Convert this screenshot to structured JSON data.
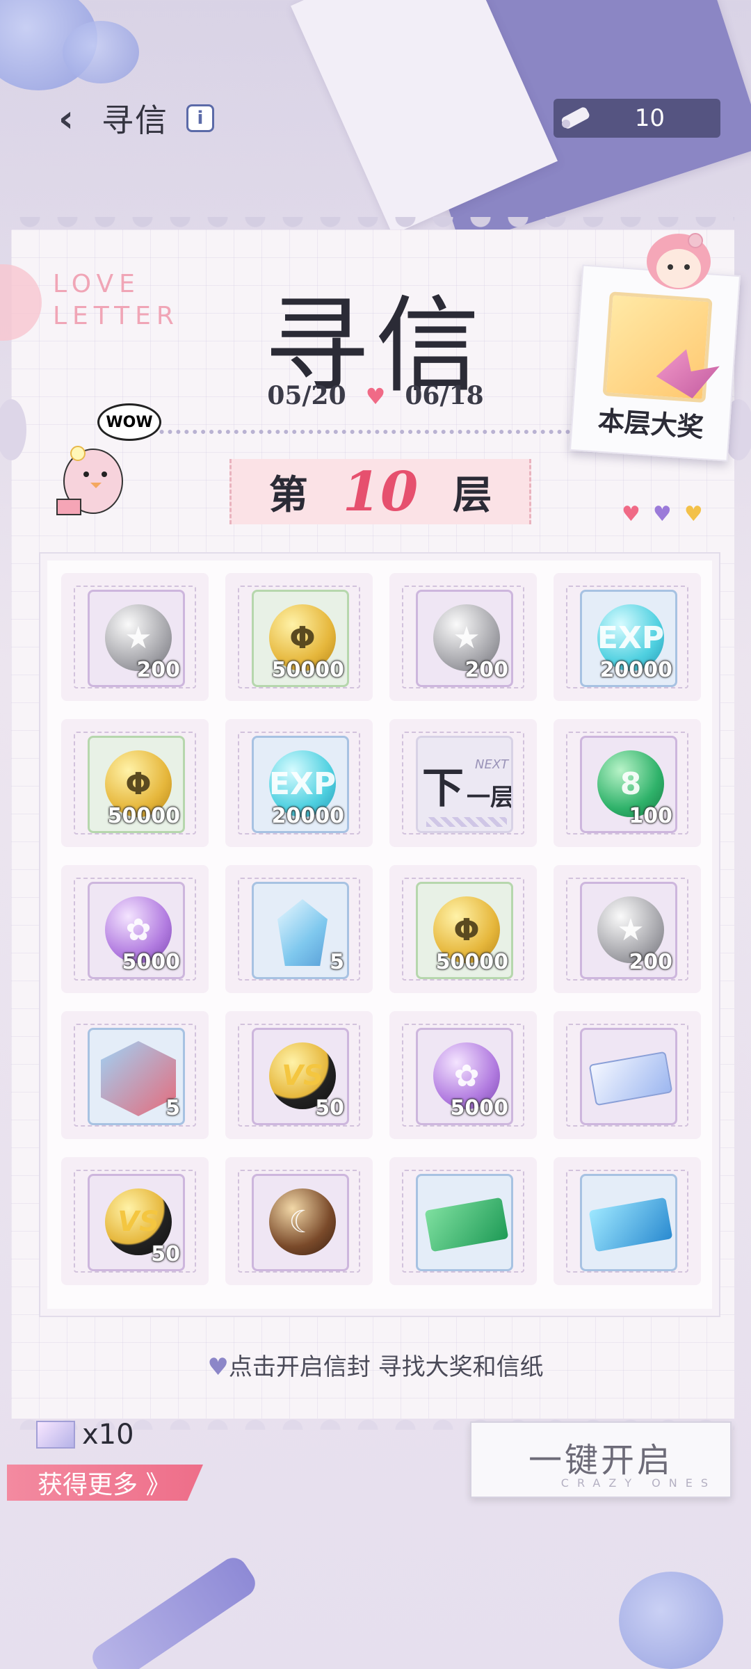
{
  "topbar": {
    "back_glyph": "‹",
    "title": "寻信",
    "info_glyph": "i"
  },
  "currency": {
    "icon": "scroll-icon",
    "value": "10"
  },
  "card": {
    "love_letter": [
      "LOVE",
      "LETTER"
    ],
    "title": "寻信",
    "date_start": "05/20",
    "date_end": "06/18",
    "date_heart": "♥",
    "wow": "WOW",
    "floor": {
      "prefix": "第",
      "number": "10",
      "suffix": "层"
    },
    "hearts": [
      {
        "color": "#f06a86"
      },
      {
        "color": "#9b7ad9"
      },
      {
        "color": "#f3c14a"
      }
    ],
    "prize_label": "本层大奖"
  },
  "grid": [
    {
      "kind": "coin",
      "style": "silver",
      "tile": "purple",
      "glyph": "★",
      "qty": "200"
    },
    {
      "kind": "coin",
      "style": "gold",
      "tile": "green",
      "glyph": "Φ",
      "qty": "50000"
    },
    {
      "kind": "coin",
      "style": "silver",
      "tile": "purple",
      "glyph": "★",
      "qty": "200"
    },
    {
      "kind": "coin",
      "style": "exp",
      "tile": "blue",
      "glyph": "EXP",
      "qty": "20000"
    },
    {
      "kind": "coin",
      "style": "gold",
      "tile": "green",
      "glyph": "Φ",
      "qty": "50000"
    },
    {
      "kind": "coin",
      "style": "exp",
      "tile": "blue",
      "glyph": "EXP",
      "qty": "20000"
    },
    {
      "kind": "next",
      "zh": "下",
      "zh2": "一层",
      "en": "NEXT"
    },
    {
      "kind": "coin",
      "style": "green",
      "tile": "purple",
      "glyph": "8",
      "qty": "100"
    },
    {
      "kind": "coin",
      "style": "purple",
      "tile": "purple",
      "glyph": "✿",
      "qty": "5000"
    },
    {
      "kind": "crystal",
      "tile": "blue",
      "qty": "5"
    },
    {
      "kind": "coin",
      "style": "gold",
      "tile": "green",
      "glyph": "Φ",
      "qty": "50000"
    },
    {
      "kind": "coin",
      "style": "silver",
      "tile": "purple",
      "glyph": "★",
      "qty": "200"
    },
    {
      "kind": "portrait",
      "tile": "blue",
      "qty": "5"
    },
    {
      "kind": "coin",
      "style": "vs",
      "tile": "purple",
      "glyph": "VS",
      "qty": "50"
    },
    {
      "kind": "coin",
      "style": "purple",
      "tile": "purple",
      "glyph": "✿",
      "qty": "5000"
    },
    {
      "kind": "ticket",
      "style": "pass",
      "tile": "purple",
      "qty": ""
    },
    {
      "kind": "coin",
      "style": "vs",
      "tile": "purple",
      "glyph": "VS",
      "qty": "50"
    },
    {
      "kind": "coin",
      "style": "dark",
      "tile": "purple",
      "glyph": "☾",
      "qty": ""
    },
    {
      "kind": "ticket",
      "style": "greent",
      "tile": "blue",
      "qty": ""
    },
    {
      "kind": "ticket",
      "style": "bluet",
      "tile": "blue",
      "qty": ""
    }
  ],
  "hint": {
    "heart": "♥",
    "text": "点击开启信封  寻找大奖和信纸"
  },
  "bottom": {
    "letters_count": "x10",
    "get_more": "获得更多 》",
    "open_all": "一键开启",
    "open_all_sub": "CRAZY ONES"
  },
  "colors": {
    "accent_pink": "#e6506e",
    "hint_heart": "#8c86c8"
  }
}
